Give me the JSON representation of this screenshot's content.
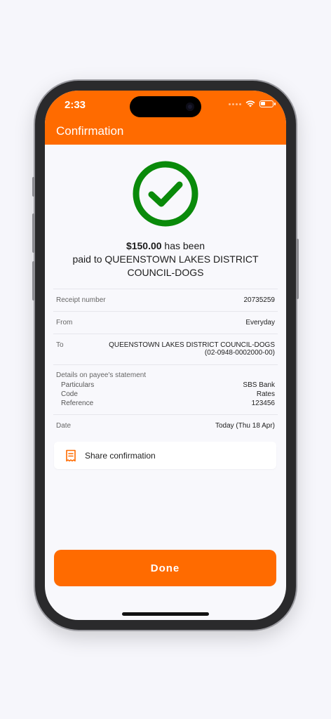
{
  "status_bar": {
    "time": "2:33"
  },
  "header": {
    "title": "Confirmation"
  },
  "confirmation": {
    "amount": "$150.00",
    "line1_suffix": " has been",
    "line2": "paid to QUEENSTOWN LAKES DISTRICT",
    "line3": "COUNCIL-DOGS"
  },
  "details": {
    "receipt_label": "Receipt number",
    "receipt_value": "20735259",
    "from_label": "From",
    "from_value": "Everyday",
    "to_label": "To",
    "to_value_line1": "QUEENSTOWN LAKES DISTRICT COUNCIL-DOGS",
    "to_value_line2": "(02-0948-0002000-00)",
    "statement_label": "Details on payee's statement",
    "particulars_label": "Particulars",
    "particulars_value": "SBS Bank",
    "code_label": "Code",
    "code_value": "Rates",
    "reference_label": "Reference",
    "reference_value": "123456",
    "date_label": "Date",
    "date_value": "Today (Thu 18 Apr)"
  },
  "share": {
    "label": "Share confirmation",
    "icon": "receipt-icon"
  },
  "done": {
    "label": "Done"
  },
  "colors": {
    "accent": "#ff6b00",
    "success": "#0a8a0a"
  }
}
